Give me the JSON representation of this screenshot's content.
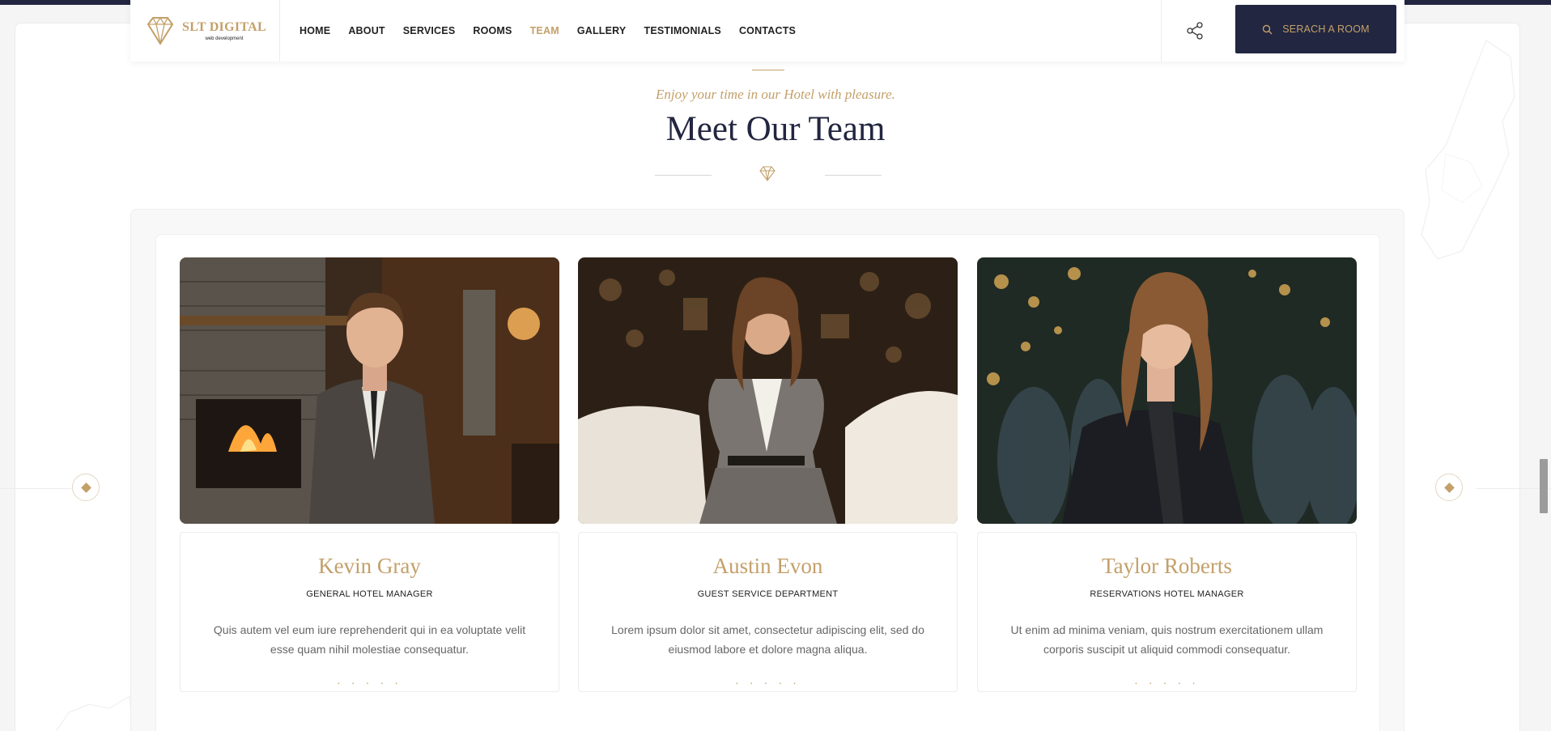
{
  "header": {
    "logo": {
      "title": "SLT DIGITAL",
      "subtitle": "web development"
    },
    "nav": [
      {
        "label": "HOME",
        "active": false
      },
      {
        "label": "ABOUT",
        "active": false
      },
      {
        "label": "SERVICES",
        "active": false
      },
      {
        "label": "ROOMS",
        "active": false
      },
      {
        "label": "TEAM",
        "active": true
      },
      {
        "label": "GALLERY",
        "active": false
      },
      {
        "label": "TESTIMONIALS",
        "active": false
      },
      {
        "label": "CONTACTS",
        "active": false
      }
    ],
    "search_button": "SERACH A ROOM"
  },
  "section": {
    "subtitle": "Enjoy your time in our Hotel with pleasure.",
    "title": "Meet Our Team"
  },
  "team": [
    {
      "name": "Kevin Gray",
      "role": "GENERAL HOTEL MANAGER",
      "description": "Quis autem vel eum iure reprehenderit qui in ea voluptate velit esse quam nihil molestiae consequatur.",
      "dots": ". . . . ."
    },
    {
      "name": "Austin Evon",
      "role": "GUEST SERVICE DEPARTMENT",
      "description": "Lorem ipsum dolor sit amet, consectetur adipiscing elit, sed do eiusmod labore et dolore magna aliqua.",
      "dots": ". . . . ."
    },
    {
      "name": "Taylor Roberts",
      "role": "RESERVATIONS HOTEL MANAGER",
      "description": "Ut enim ad minima veniam, quis nostrum exercitationem ullam corporis suscipit ut aliquid commodi consequatur.",
      "dots": ". . . . ."
    }
  ],
  "colors": {
    "gold": "#c3a06a",
    "navy": "#222640"
  }
}
